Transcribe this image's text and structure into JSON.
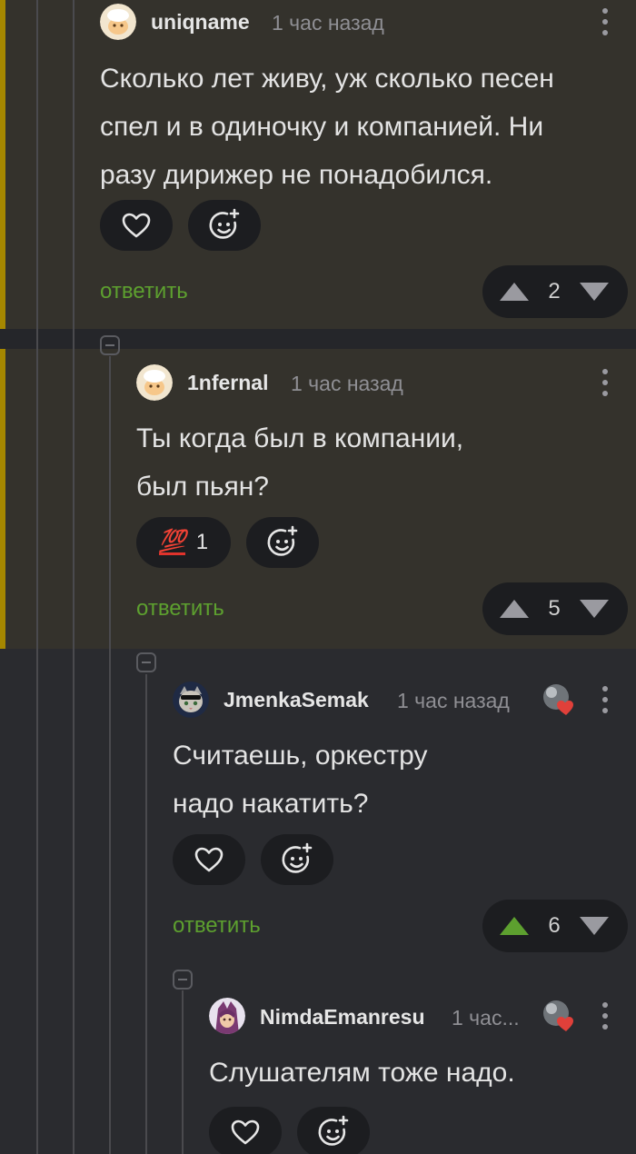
{
  "comments": [
    {
      "username": "uniqname",
      "time": "1 час назад",
      "text_lines": [
        "Сколько лет живу, уж сколько песен",
        "спел и в одиночку и компанией. Ни",
        "разу дирижер не понадобился."
      ],
      "reply_label": "ответить",
      "rating": "2"
    },
    {
      "username": "1nfernal",
      "time": "1 час назад",
      "text_lines": [
        "Ты когда был в компании,",
        "был пьян?"
      ],
      "reaction_emoji": "💯",
      "reaction_count": "1",
      "reply_label": "ответить",
      "rating": "5"
    },
    {
      "username": "JmenkaSemak",
      "time": "1 час назад",
      "text_lines": [
        "Считаешь, оркестру",
        "надо накатить?"
      ],
      "reply_label": "ответить",
      "rating": "6"
    },
    {
      "username": "NimdaEmanresu",
      "time": "1 час...",
      "text_lines": [
        "Слушателям тоже надо."
      ]
    }
  ],
  "colors": {
    "accent_bar": "#a58700",
    "reply_link": "#5da02f",
    "upvote_active": "#5da02f",
    "heart_badge": "#e0403a"
  },
  "icons": {
    "like": "heart-icon",
    "add_reaction": "add-emoji-icon",
    "upvote": "triangle-up-icon",
    "downvote": "triangle-down-icon",
    "menu": "kebab-menu-icon",
    "collapse": "collapse-minus-icon",
    "badge": "heart-badge-icon"
  }
}
